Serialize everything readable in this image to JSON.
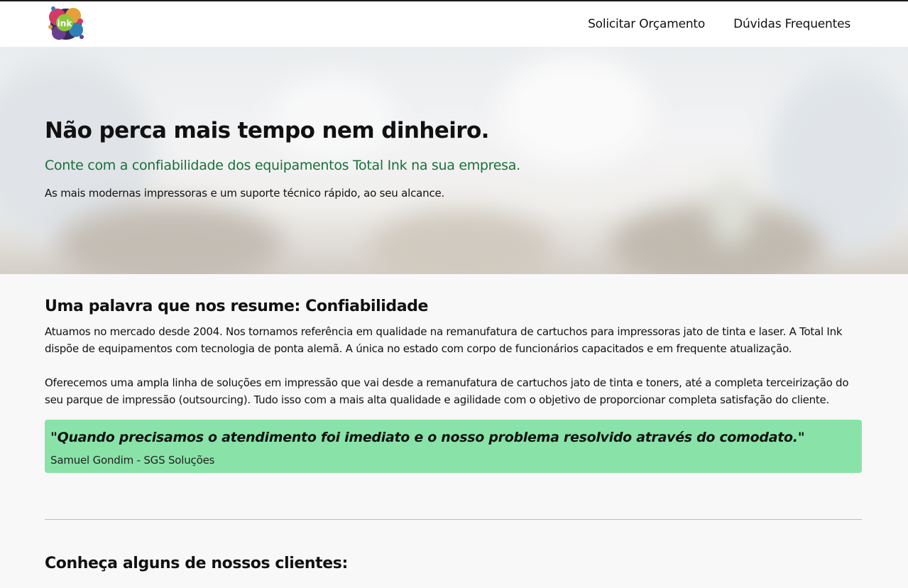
{
  "header": {
    "logo_text": "ink",
    "nav": [
      {
        "label": "Solicitar Orçamento"
      },
      {
        "label": "Dúvidas Frequentes"
      }
    ]
  },
  "hero": {
    "title": "Não perca mais tempo nem dinheiro.",
    "subtitle": "Conte com a confiabilidade dos equipamentos Total Ink na sua empresa.",
    "text": "As mais modernas impressoras e um suporte técnico rápido, ao seu alcance."
  },
  "about": {
    "title": "Uma palavra que nos resume: Confiabilidade",
    "paragraph1": "Atuamos no mercado desde 2004. Nos tornamos referência em qualidade na remanufatura de cartuchos para impressoras jato de tinta e laser. A Total Ink dispõe de equipamentos com tecnologia de ponta alemã. A única no estado com corpo de funcionários capacitados e em frequente atualização.",
    "paragraph2": "Oferecemos uma ampla linha de soluções em impressão que vai desde a remanufatura de cartuchos jato de tinta e toners, até a completa terceirização do seu parque de impressão (outsourcing). Tudo isso com a mais alta qualidade e agilidade com o objetivo de proporcionar completa satisfação do cliente."
  },
  "testimonial": {
    "quote": "\"Quando precisamos o atendimento foi imediato e o nosso problema resolvido através do comodato.\"",
    "author": "Samuel Gondim - SGS Soluções"
  },
  "clients": {
    "title": "Conheça alguns de nossos clientes:"
  },
  "colors": {
    "accent_green": "#17703a",
    "quote_bg": "#89e3a8",
    "divider": "#8fd7a6"
  }
}
